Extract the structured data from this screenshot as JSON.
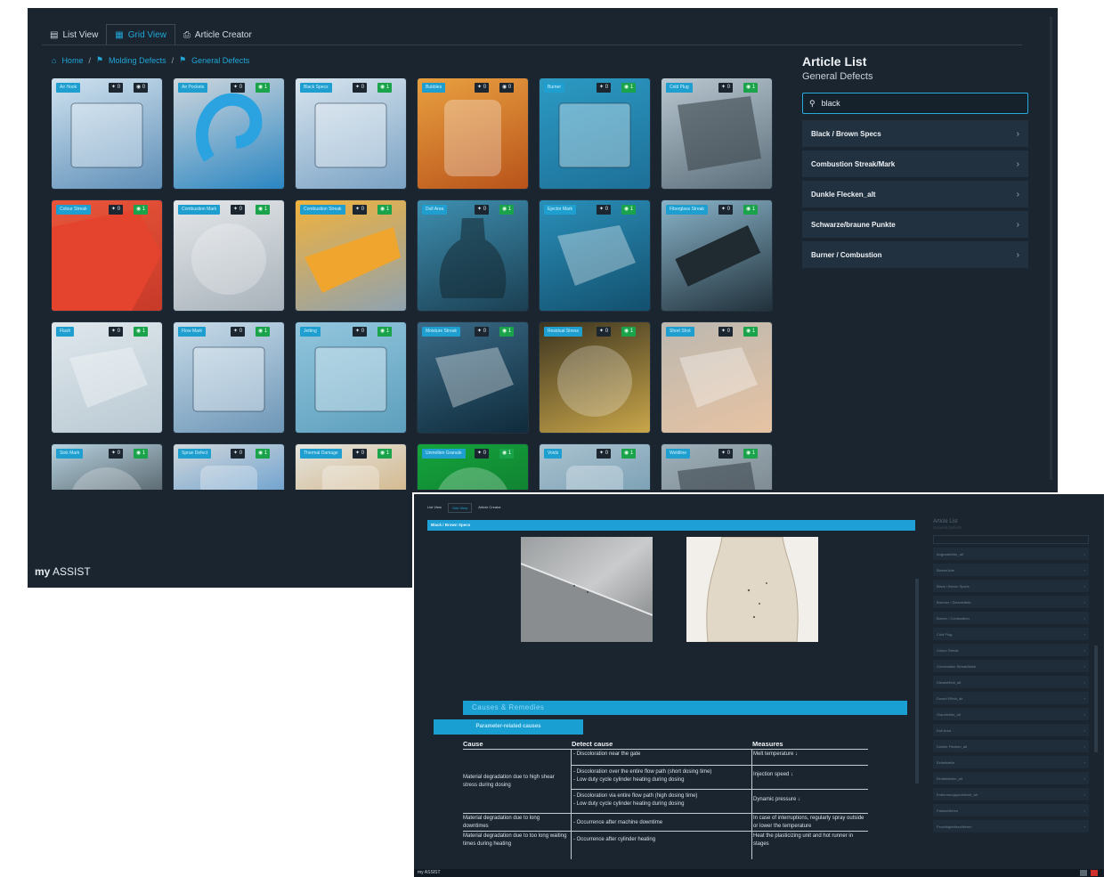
{
  "window1": {
    "tabs": [
      {
        "label": "List View",
        "icon": "list-icon"
      },
      {
        "label": "Grid View",
        "icon": "grid-icon",
        "active": true
      },
      {
        "label": "Article Creator",
        "icon": "printer-icon"
      }
    ],
    "breadcrumb": [
      {
        "label": "Home",
        "icon": "home-icon"
      },
      {
        "label": "Molding Defects",
        "icon": "tag-icon"
      },
      {
        "label": "General Defects",
        "icon": "tag-icon"
      }
    ],
    "tiles": [
      {
        "label": "Air Hook",
        "count1": "0",
        "count2": "0"
      },
      {
        "label": "Air Pockets",
        "count1": "0",
        "count2": "1"
      },
      {
        "label": "Black Specs",
        "count1": "0",
        "count2": "1"
      },
      {
        "label": "Bubbles",
        "count1": "0",
        "count2": "0"
      },
      {
        "label": "Burner",
        "count1": "0",
        "count2": "1"
      },
      {
        "label": "Cold Plug",
        "count1": "0",
        "count2": "1"
      },
      {
        "label": "Colour Streak",
        "count1": "0",
        "count2": "1"
      },
      {
        "label": "Combustion Mark",
        "count1": "0",
        "count2": "1"
      },
      {
        "label": "Combustion Streak",
        "count1": "0",
        "count2": "1"
      },
      {
        "label": "Dull Area",
        "count1": "0",
        "count2": "1"
      },
      {
        "label": "Ejector Mark",
        "count1": "0",
        "count2": "1"
      },
      {
        "label": "Fiberglass Streak",
        "count1": "0",
        "count2": "1"
      },
      {
        "label": "Flash",
        "count1": "0",
        "count2": "1"
      },
      {
        "label": "Flow Mark",
        "count1": "0",
        "count2": "1"
      },
      {
        "label": "Jetting",
        "count1": "0",
        "count2": "1"
      },
      {
        "label": "Moisture Streak",
        "count1": "0",
        "count2": "1"
      },
      {
        "label": "Residual Stress",
        "count1": "0",
        "count2": "1"
      },
      {
        "label": "Short Shot",
        "count1": "0",
        "count2": "1"
      },
      {
        "label": "Sink Mark",
        "count1": "0",
        "count2": "1"
      },
      {
        "label": "Sprue Defect",
        "count1": "0",
        "count2": "1"
      },
      {
        "label": "Thermal Damage",
        "count1": "0",
        "count2": "1"
      },
      {
        "label": "Unmolten Granule",
        "count1": "0",
        "count2": "1"
      },
      {
        "label": "Voids",
        "count1": "0",
        "count2": "1"
      },
      {
        "label": "Weldline",
        "count1": "0",
        "count2": "1"
      }
    ],
    "sidebar": {
      "title": "Article List",
      "subtitle": "General Defects",
      "search_value": "black",
      "items": [
        "Black / Brown Specs",
        "Combustion Streak/Mark",
        "Dunkle Flecken_alt",
        "Schwarze/braune Punkte",
        "Burner / Combustion"
      ]
    },
    "brand": {
      "prefix": "my",
      "name": "ASSIST"
    }
  },
  "window2": {
    "tabs": [
      {
        "label": "List View"
      },
      {
        "label": "Grid View",
        "active": true
      },
      {
        "label": "Article Creator"
      }
    ],
    "article_title": "Black / Brown Specs",
    "section_title": "Causes & Remedies",
    "subsection_title": "Parameter-related causes",
    "table": {
      "headers": [
        "Cause",
        "Detect cause",
        "Measures"
      ],
      "rows": [
        {
          "cause": "",
          "detect": "- Discoloration near the gate",
          "measures": "Melt temperature ↓"
        },
        {
          "cause": "Material degradation due to high shear stress during dosing",
          "detect": "- Discoloration over the entire flow path (short dosing time)\n- Low duty cycle cylinder heating during dosing",
          "measures": "Injection speed ↓"
        },
        {
          "cause": "",
          "detect": "- Discoloration via entire flow path (high dosing time)\n- Low duty cycle cylinder heating during dosing",
          "measures": "Dynamic pressure ↓"
        },
        {
          "cause": "Material degradation due to long downtimes",
          "detect": "- Occurrence after machine downtime",
          "measures": "In case of interruptions, regularly spray outside or lower the temperature"
        },
        {
          "cause": "Material degradation due to too long waiting times during heating",
          "detect": "- Occurrence after cylinder heating",
          "measures": "Heat the plasticizing unit and hot runner in stages"
        }
      ]
    },
    "sidebar": {
      "title": "Article List",
      "subtitle": "General Defects",
      "items": [
        "Angussfehler_alt",
        "Blasbrüche",
        "Black / Brown Specs",
        "Brenner / Dieseleffekt",
        "Burner / Combustion",
        "Cold Plug",
        "Colour Streak",
        "Combustion Streak/Mark",
        "Dieseleffekt_alt",
        "Dosed Effekt_alt",
        "Glanzfehler_alt",
        "Dull Area",
        "Dunkle Flecken_alt",
        "Einfallstelle",
        "Einfallstellen_alt",
        "Entformungsprobleme_alt",
        "Farbschlieren",
        "Feuchtigkeitsschlieren"
      ]
    },
    "footer_brand": "my ASSIST"
  },
  "colors": {
    "background": "#1a2530",
    "accent": "#21a7d8",
    "badge_green": "#1aa34a"
  }
}
